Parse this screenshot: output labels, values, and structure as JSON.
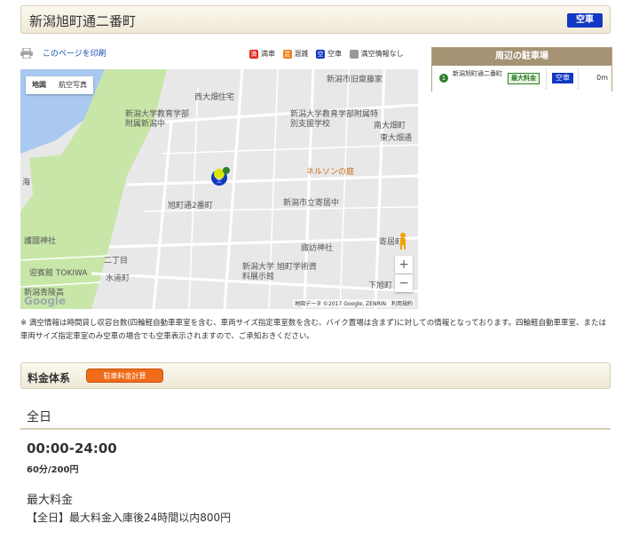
{
  "header": {
    "title": "新潟旭町通二番町",
    "status_badge": "空車"
  },
  "print": {
    "label": "このページを印刷"
  },
  "legend": [
    {
      "symbol": "満",
      "label": "満車",
      "color": "#e0261b"
    },
    {
      "symbol": "混",
      "label": "混雑",
      "color": "#f07c13"
    },
    {
      "symbol": "空",
      "label": "空車",
      "color": "#1237c4"
    },
    {
      "symbol": "",
      "label": "満空情報なし",
      "color": "#999999"
    }
  ],
  "map": {
    "buttons": [
      "地図",
      "航空写真"
    ],
    "labels": [
      "新潟市旧齋藤家",
      "西大畑住宅",
      "新潟大学教育学部附属新潟中",
      "新潟大学教育学部附属特別支援学校",
      "南大畑町",
      "東大畑通",
      "ネルソンの庭",
      "旭町通2番町",
      "新潟市立寄居中",
      "護國神社",
      "諏訪神社",
      "寄居町",
      "二丁目",
      "迎賓館 TOKIWA",
      "水道町",
      "新潟大学 旭町学術資料展示館",
      "新潟青陵高",
      "下旭町",
      "海"
    ],
    "credit": "地図データ ©2017 Google, ZENRIN　利用規約",
    "google": "Google",
    "zoom_in": "+",
    "zoom_out": "−"
  },
  "nearby": {
    "title": "周辺の駐車場",
    "items": [
      {
        "number": "1",
        "name": "新潟旭町通二番町",
        "max_fee": "最大料金",
        "status": "空車",
        "distance": "0m"
      }
    ]
  },
  "note": "※ 満空情報は時間貸し収容台数(四輪軽自動車車室を含む、車両サイズ指定車室数を含む、バイク置場は含まず)に対しての情報となっております。四輪軽自動車車室、または車両サイズ指定車室のみ空車の場合でも空車表示されますので、ご承知おきください。",
  "fees": {
    "section_label": "料金体系",
    "calc_button": "駐車料金計算",
    "day_label": "全日",
    "time": "00:00-24:00",
    "price": "60分/200円",
    "max_title": "最大料金",
    "max_desc": "【全日】最大料金入庫後24時間以内800円"
  }
}
